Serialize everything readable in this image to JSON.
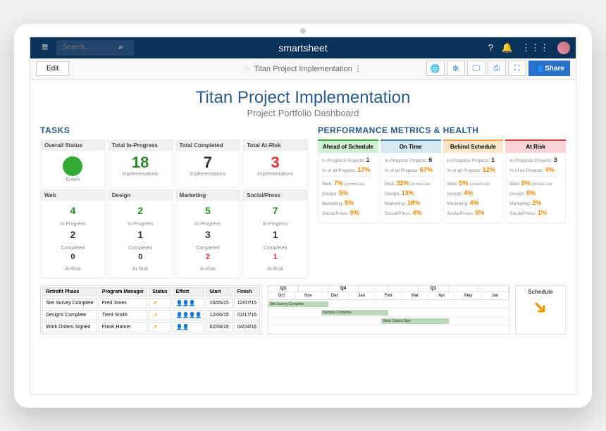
{
  "brand": "smartsheet",
  "search_placeholder": "Search...",
  "edit_label": "Edit",
  "sheet_title": "Titan Project Implementation",
  "share_label": "Share",
  "main_title": "Titan Project Implementation",
  "subtitle": "Project Portfolio Dashboard",
  "tasks_title": "TASKS",
  "health_title": "PERFORMANCE METRICS & HEALTH",
  "summary_cards": [
    {
      "head": "Overall Status",
      "dot": true,
      "label": "Green"
    },
    {
      "head": "Total In-Progress",
      "num": "18",
      "color": "c-green",
      "label": "Implementations"
    },
    {
      "head": "Total Completed",
      "num": "7",
      "color": "c-dark",
      "label": "Implementations"
    },
    {
      "head": "Total At-Risk",
      "num": "3",
      "color": "c-red",
      "label": "Implementations"
    }
  ],
  "category_cards": [
    {
      "head": "Web",
      "ip": "4",
      "comp": "2",
      "risk": "0",
      "risk_c": "c-dark"
    },
    {
      "head": "Design",
      "ip": "2",
      "comp": "1",
      "risk": "0",
      "risk_c": "c-dark"
    },
    {
      "head": "Marketing",
      "ip": "5",
      "comp": "3",
      "risk": "2",
      "risk_c": "c-red"
    },
    {
      "head": "Social/Press",
      "ip": "7",
      "comp": "1",
      "risk": "1",
      "risk_c": "c-red"
    }
  ],
  "ip_label": "In-Progress",
  "comp_label": "Completed",
  "risk_label": "At-Risk",
  "health_cards": [
    {
      "head": "Ahead of Schedule",
      "cls": "h-green",
      "proj": "1",
      "pct": "17%",
      "web": "7%",
      "design": "5%",
      "mkt": "5%",
      "sp": "0%"
    },
    {
      "head": "On Time",
      "cls": "h-blue",
      "proj": "6",
      "pct": "67%",
      "web": "32%",
      "design": "13%",
      "mkt": "18%",
      "sp": "4%"
    },
    {
      "head": "Behind Schedule",
      "cls": "h-yellow",
      "proj": "1",
      "pct": "12%",
      "web": "5%",
      "design": "4%",
      "mkt": "4%",
      "sp": "0%"
    },
    {
      "head": "At Risk",
      "cls": "h-red",
      "proj": "3",
      "pct": "4%",
      "web": "0%",
      "design": "0%",
      "mkt": "2%",
      "sp": "1%"
    }
  ],
  "health_labels": {
    "proj": "In-Progress Projects:",
    "pct": "% of all Projects:",
    "web": "Web:",
    "design": "Design:",
    "mkt": "Marketing:",
    "sp": "Social/Press:"
  },
  "gantt_headers": [
    "Retrofit Phase",
    "Program Manager",
    "Status",
    "Effort",
    "Start",
    "Finish"
  ],
  "gantt_rows": [
    {
      "phase": "Site Survey Complete",
      "pm": "Fred Jones",
      "status": "↗",
      "effort": "👤👤👤",
      "start": "10/05/15",
      "finish": "12/07/15"
    },
    {
      "phase": "Designs Complete",
      "pm": "Trent Smith",
      "status": "↗",
      "effort": "👤👤👤👤",
      "start": "12/06/15",
      "finish": "02/17/16"
    },
    {
      "phase": "Work Orders Signed",
      "pm": "Frank Hamer",
      "status": "↗",
      "effort": "👤👤",
      "start": "02/08/16",
      "finish": "04/24/16"
    }
  ],
  "gantt_quarters": [
    "Q3",
    "",
    "Q4",
    "",
    "",
    "Q1",
    "",
    ""
  ],
  "gantt_months": [
    "Oct",
    "Nov",
    "Dec",
    "Jan",
    "Feb",
    "Mar",
    "Apr",
    "May",
    "Jun"
  ],
  "gantt_bars": [
    {
      "label": "Site Survey Complete",
      "left": "0%",
      "width": "25%"
    },
    {
      "label": "Designs Complete",
      "left": "22%",
      "width": "28%"
    },
    {
      "label": "Work Orders Sign",
      "left": "47%",
      "width": "28%"
    }
  ],
  "schedule_label": "Schedule"
}
